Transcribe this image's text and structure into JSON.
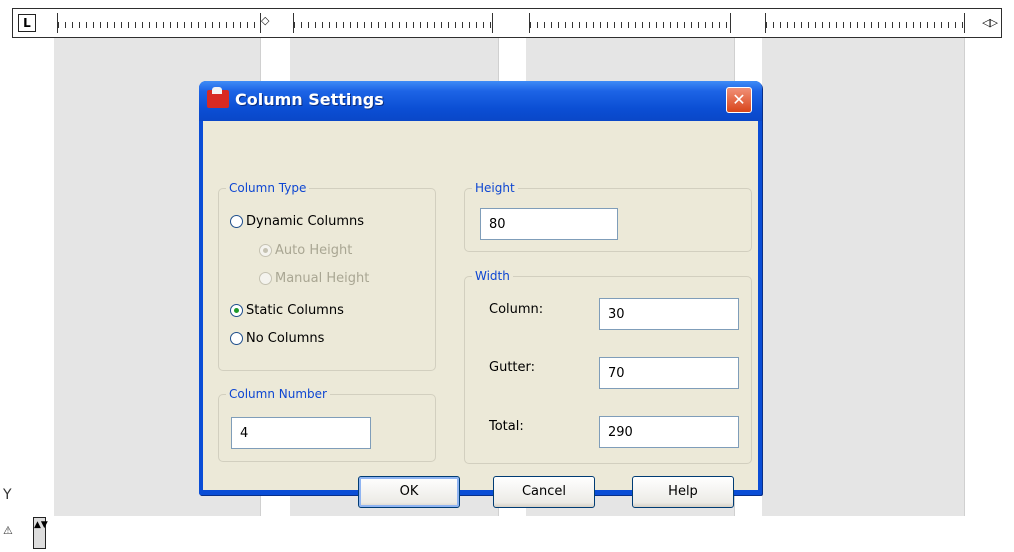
{
  "ruler": {
    "tab_selector": "L",
    "end_glyph": "◁▷"
  },
  "dialog": {
    "title": "Column Settings",
    "close_glyph": "✕",
    "column_type": {
      "group_label": "Column Type",
      "options": {
        "dynamic": "Dynamic Columns",
        "auto_height": "Auto Height",
        "manual_height": "Manual Height",
        "static": "Static Columns",
        "none": "No Columns"
      },
      "selected": "static"
    },
    "column_number": {
      "group_label": "Column Number",
      "value": "4"
    },
    "height": {
      "group_label": "Height",
      "value": "80"
    },
    "width": {
      "group_label": "Width",
      "column_label": "Column:",
      "column_value": "30",
      "gutter_label": "Gutter:",
      "gutter_value": "70",
      "total_label": "Total:",
      "total_value": "290"
    },
    "buttons": {
      "ok": "OK",
      "cancel": "Cancel",
      "help": "Help"
    }
  },
  "side_icons": {
    "y_axis": "Y",
    "triangle": "⚠",
    "spin": "▲▼"
  },
  "colors": {
    "titlebar": "#0a4dd6",
    "client_bg": "#ece9d8",
    "group_title": "#0e46d2",
    "page_column": "#e5e5e5"
  }
}
